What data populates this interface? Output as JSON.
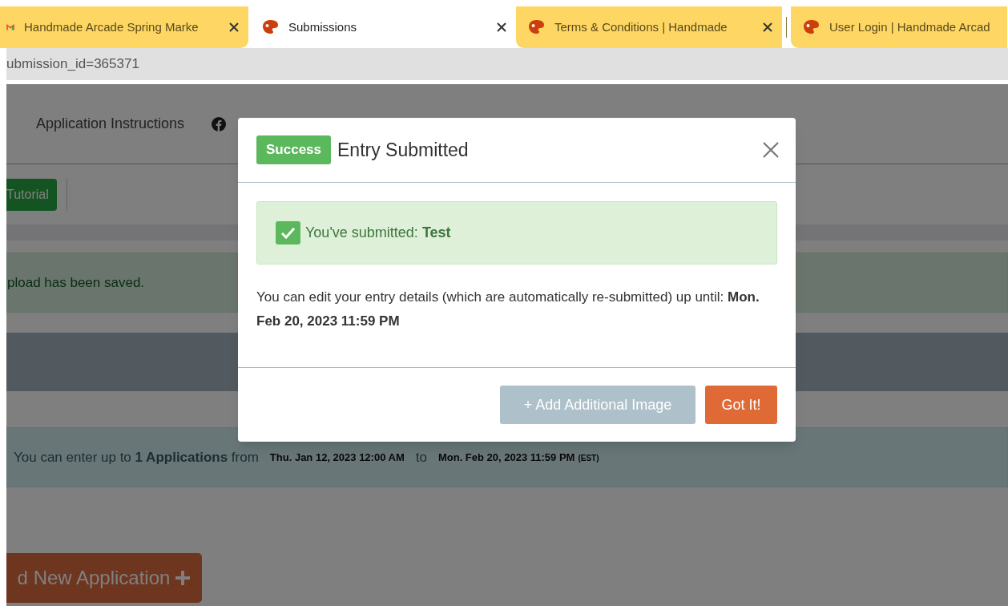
{
  "tabs": [
    {
      "title": "Handmade Arcade Spring Marke",
      "kind": "mail",
      "selected": false,
      "closable": true
    },
    {
      "title": "Submissions",
      "kind": "palette",
      "selected": true,
      "closable": true
    },
    {
      "title": "Terms & Conditions | Handmade",
      "kind": "palette",
      "selected": false,
      "closable": true
    },
    {
      "title": "User Login | Handmade Arcad",
      "kind": "palette",
      "selected": false,
      "closable": false
    }
  ],
  "address_bar": {
    "url": "ubmission_id=365371"
  },
  "page": {
    "nav_links": [
      "Application Instructions"
    ],
    "tutorial_button": "Tutorial",
    "saved_alert": "pload has been saved.",
    "entry_info": {
      "text": "You can enter up to **1 Applications** from",
      "start": "Thu. Jan 12, 2023 12:00 AM",
      "separator": "to",
      "end": "Mon. Feb 20, 2023 11:59 PM",
      "timezone": "(EST)"
    },
    "new_application_button": "d New Application"
  },
  "modal": {
    "badge": "Success",
    "title": "Entry Submitted",
    "alert": "You've submitted: **Test**",
    "message": "You can edit your entry details (which are automatically re-submitted) up until: **Mon. Feb 20, 2023 11:59 PM**",
    "buttons": [
      {
        "label": "+ Add Additional Image",
        "kind": "secondary",
        "disabled": true
      },
      {
        "label": "Got It!",
        "kind": "primary",
        "disabled": false
      }
    ]
  }
}
